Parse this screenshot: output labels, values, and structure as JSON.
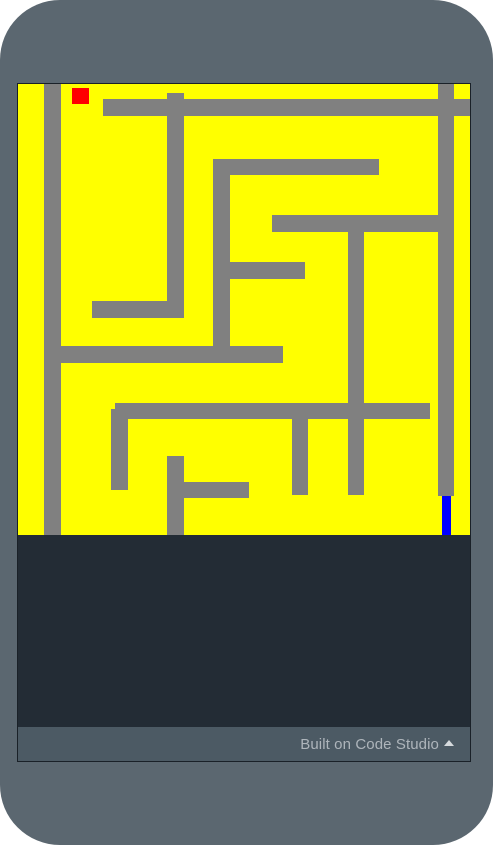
{
  "footer": {
    "label": "Built on Code Studio",
    "menu_icon": "caret-up-icon"
  },
  "game": {
    "background_color": "#ffff00",
    "wall_color": "#808080",
    "player_color": "#ff0000",
    "goal_color": "#0000ff"
  }
}
